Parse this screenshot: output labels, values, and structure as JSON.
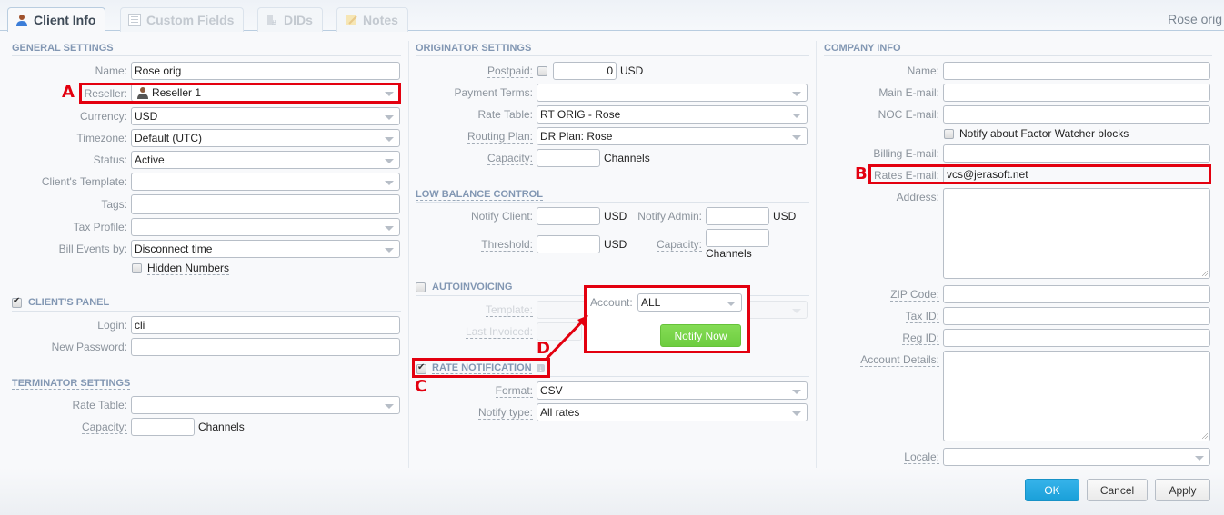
{
  "tabs": [
    {
      "label": "Client Info",
      "icon": "client-icon",
      "active": true
    },
    {
      "label": "Custom Fields",
      "icon": "list-icon",
      "active": false
    },
    {
      "label": "DIDs",
      "icon": "did-icon",
      "active": false
    },
    {
      "label": "Notes",
      "icon": "note-icon",
      "active": false
    }
  ],
  "window_title": "Rose orig",
  "general": {
    "title": "GENERAL SETTINGS",
    "name_label": "Name:",
    "name_value": "Rose orig",
    "reseller_label": "Reseller:",
    "reseller_value": "Reseller 1",
    "currency_label": "Currency:",
    "currency_value": "USD",
    "timezone_label": "Timezone:",
    "timezone_value": "Default (UTC)",
    "status_label": "Status:",
    "status_value": "Active",
    "template_label": "Client's Template:",
    "template_value": "",
    "tags_label": "Tags:",
    "tags_value": "",
    "tax_label": "Tax Profile:",
    "tax_value": "",
    "bill_label": "Bill Events by:",
    "bill_value": "Disconnect time",
    "hidden_numbers_label": "Hidden Numbers",
    "hidden_numbers_checked": false
  },
  "clients_panel": {
    "title": "CLIENT'S PANEL",
    "enabled": true,
    "login_label": "Login:",
    "login_value": "cli",
    "password_label": "New Password:",
    "password_value": ""
  },
  "terminator": {
    "title": "TERMINATOR SETTINGS",
    "rate_table_label": "Rate Table:",
    "rate_table_value": "",
    "capacity_label": "Capacity:",
    "capacity_value": "",
    "capacity_unit": "Channels"
  },
  "originator": {
    "title": "ORIGINATOR SETTINGS",
    "postpaid_label": "Postpaid:",
    "postpaid_checked": false,
    "postpaid_value": "0",
    "postpaid_unit": "USD",
    "payment_terms_label": "Payment Terms:",
    "payment_terms_value": "",
    "rate_table_label": "Rate Table:",
    "rate_table_value": "RT ORIG - Rose",
    "routing_plan_label": "Routing Plan:",
    "routing_plan_value": "DR Plan: Rose",
    "capacity_label": "Capacity:",
    "capacity_value": "",
    "capacity_unit": "Channels"
  },
  "low_balance": {
    "title": "LOW BALANCE CONTROL",
    "notify_client_label": "Notify Client:",
    "notify_client_unit": "USD",
    "notify_admin_label": "Notify Admin:",
    "notify_admin_unit": "USD",
    "threshold_label": "Threshold:",
    "threshold_unit": "USD",
    "capacity_label": "Capacity:",
    "capacity_unit": "Channels"
  },
  "autoinvoicing": {
    "title": "AUTOINVOICING",
    "enabled": false,
    "template_label": "Template:",
    "last_invoiced_label": "Last Invoiced:"
  },
  "rate_notification": {
    "title": "RATE NOTIFICATION",
    "enabled": true,
    "format_label": "Format:",
    "format_value": "CSV",
    "notify_type_label": "Notify type:",
    "notify_type_value": "All rates"
  },
  "popup": {
    "account_label": "Account:",
    "account_value": "ALL",
    "notify_now_label": "Notify Now"
  },
  "company": {
    "title": "COMPANY INFO",
    "name_label": "Name:",
    "main_email_label": "Main E-mail:",
    "noc_email_label": "NOC E-mail:",
    "factor_watcher_label": "Notify about Factor Watcher blocks",
    "factor_watcher_checked": false,
    "billing_email_label": "Billing E-mail:",
    "rates_email_label": "Rates E-mail:",
    "rates_email_value": "vcs@jerasoft.net",
    "address_label": "Address:",
    "zip_label": "ZIP Code:",
    "tax_id_label": "Tax ID:",
    "reg_id_label": "Reg ID:",
    "account_details_label": "Account Details:",
    "locale_label": "Locale:"
  },
  "annotations": {
    "a": "A",
    "b": "B",
    "c": "C",
    "d": "D",
    "color": "#e3000f"
  },
  "footer": {
    "ok_label": "OK",
    "cancel_label": "Cancel",
    "apply_label": "Apply"
  }
}
